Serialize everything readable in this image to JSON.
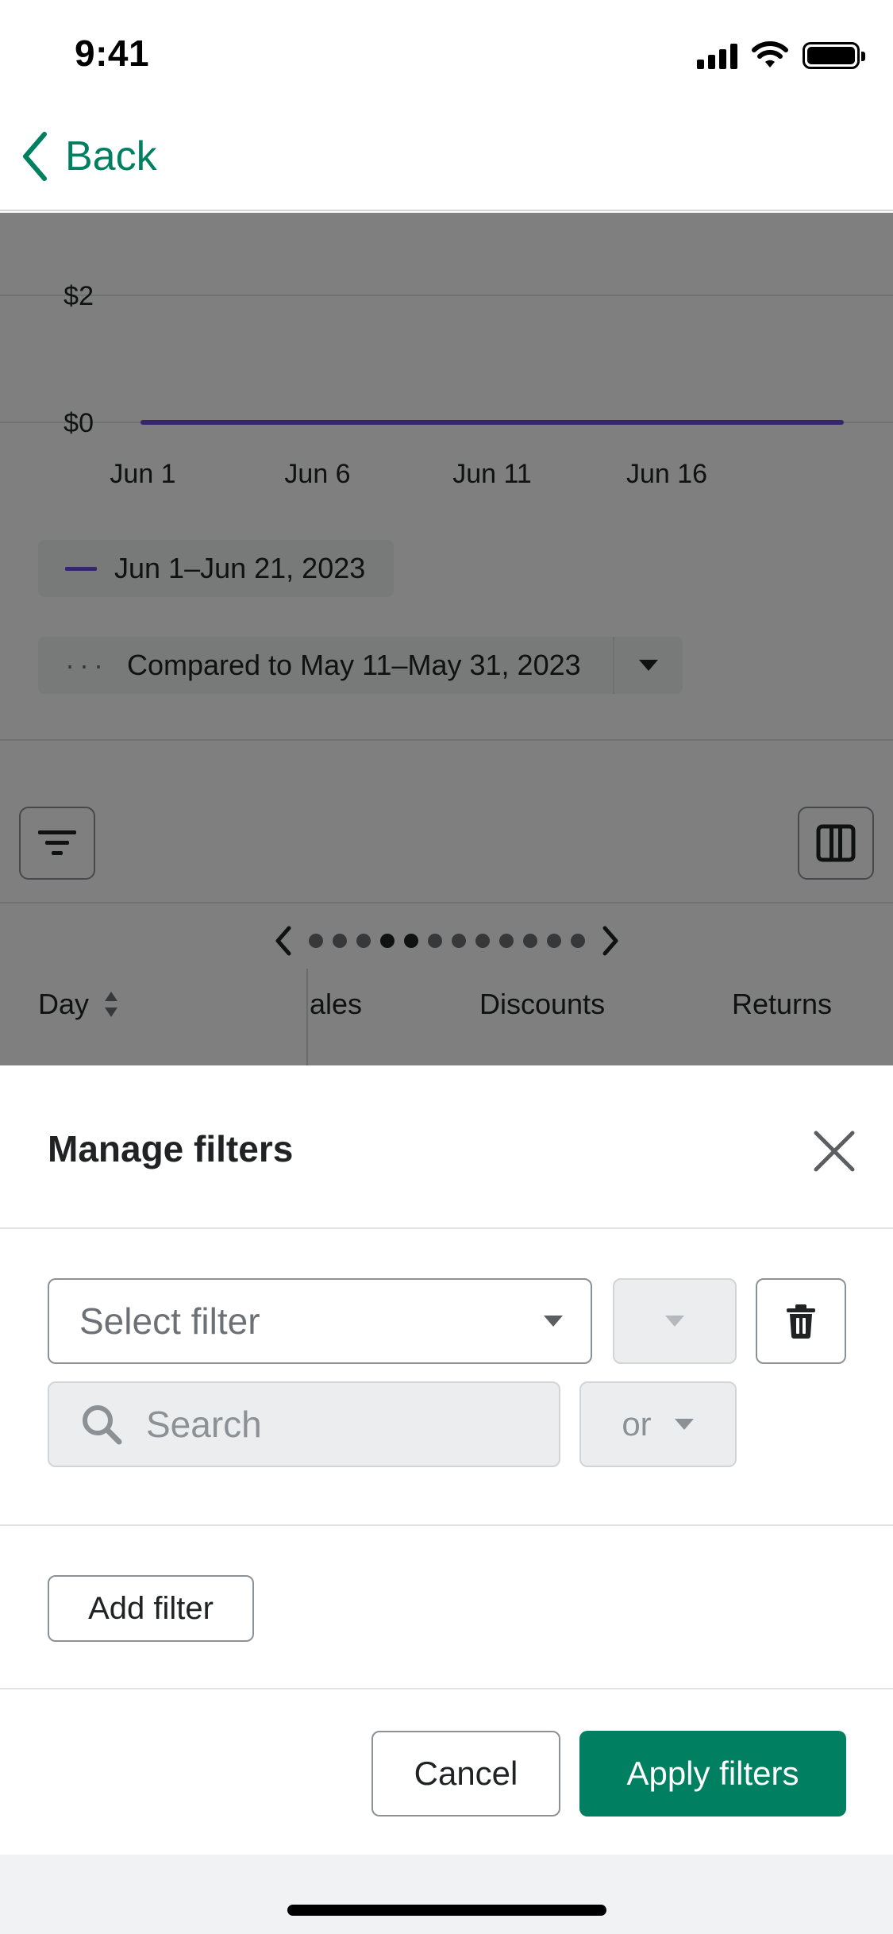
{
  "status_bar": {
    "time": "9:41"
  },
  "nav": {
    "back_label": "Back"
  },
  "chart_data": {
    "type": "line",
    "x_ticks": [
      "Jun 1",
      "Jun 6",
      "Jun 11",
      "Jun 16"
    ],
    "y_ticks": [
      "$2",
      "$0"
    ],
    "series": [
      {
        "name": "Jun 1–Jun 21, 2023",
        "color": "#6c4bd8",
        "x": [
          "Jun 1",
          "Jun 21"
        ],
        "values": [
          0,
          0
        ]
      }
    ],
    "ylim": [
      0,
      2
    ],
    "grid": true
  },
  "legend": {
    "primary": "Jun 1–Jun 21, 2023",
    "comparison": "Compared to May 11–May 31, 2023"
  },
  "table": {
    "columns": {
      "day": "Day",
      "sales": "ales",
      "discounts": "Discounts",
      "returns": "Returns"
    },
    "page_dots": 12,
    "active_dots": [
      3,
      4
    ]
  },
  "sheet": {
    "title": "Manage filters",
    "select_filter_placeholder": "Select filter",
    "search_placeholder": "Search",
    "conjunction": "or",
    "add_filter_label": "Add filter",
    "cancel_label": "Cancel",
    "apply_label": "Apply filters"
  },
  "colors": {
    "accent": "#008060",
    "series": "#6c4bd8",
    "overlay": "rgba(0,0,0,0.5)"
  },
  "icons": [
    "chevron-left-icon",
    "signal-icon",
    "wifi-icon",
    "battery-icon",
    "filter-lines-icon",
    "columns-icon",
    "chevron-down-icon",
    "trash-icon",
    "search-icon",
    "close-icon",
    "sort-icon"
  ]
}
